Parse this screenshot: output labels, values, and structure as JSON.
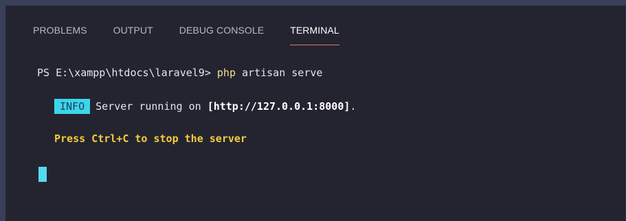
{
  "panel": {
    "tabs": [
      {
        "label": "PROBLEMS",
        "active": false
      },
      {
        "label": "OUTPUT",
        "active": false
      },
      {
        "label": "DEBUG CONSOLE",
        "active": false
      },
      {
        "label": "TERMINAL",
        "active": true
      }
    ]
  },
  "terminal": {
    "prompt": "PS E:\\xampp\\htdocs\\laravel9> ",
    "command": "php",
    "args": " artisan serve",
    "info_badge": "INFO",
    "info_text": "Server running on ",
    "info_url": "[http://127.0.0.1:8000]",
    "info_suffix": ".",
    "hint": "Press Ctrl+C to stop the server"
  },
  "colors": {
    "background": "#242431",
    "badge": "#3cd6ea",
    "command": "#f5e08a",
    "hint": "#f3cd3a",
    "cursor": "#58d9f0",
    "active_tab_underline": "#e07a6a"
  }
}
